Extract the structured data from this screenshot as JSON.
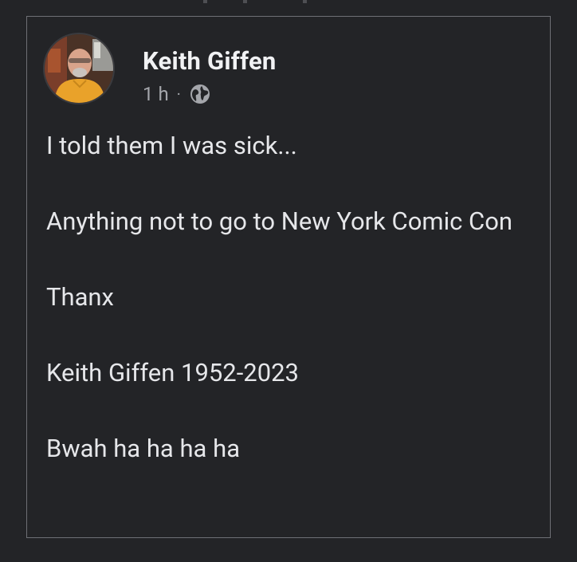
{
  "post": {
    "author": "Keith Giffen",
    "timestamp": "1 h",
    "separator": "·",
    "privacy_icon": "globe-icon",
    "paragraphs": [
      "I told them I was sick...",
      "Anything not to go to New York Comic Con",
      "Thanx",
      "Keith Giffen 1952-2023",
      "Bwah ha ha ha ha"
    ]
  },
  "colors": {
    "background": "#232427",
    "card_border": "#6e7075",
    "author_text": "#f1f2f4",
    "body_text": "#e6e7ea",
    "meta_text": "#a4a6ab"
  }
}
